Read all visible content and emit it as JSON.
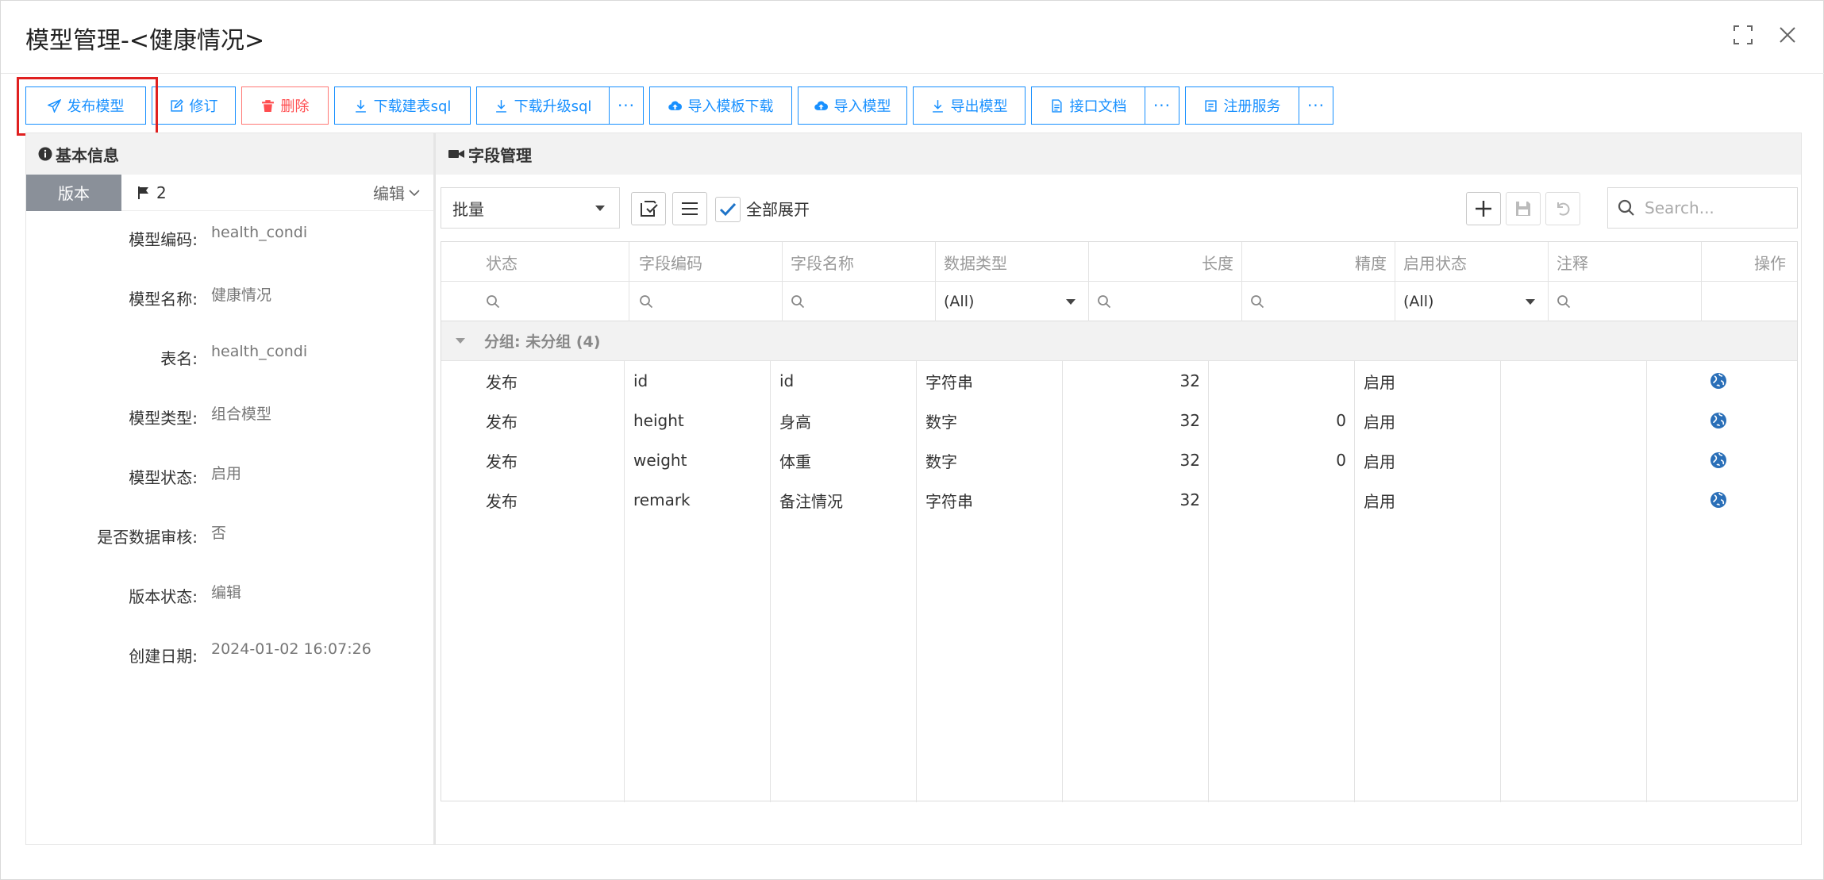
{
  "window": {
    "title": "模型管理-<健康情况>"
  },
  "toolbar": {
    "publish": "发布模型",
    "revise": "修订",
    "delete": "删除",
    "download_create_sql": "下载建表sql",
    "download_upgrade_sql": "下载升级sql",
    "import_template_download": "导入模板下载",
    "import_model": "导入模型",
    "export_model": "导出模型",
    "api_doc": "接口文档",
    "register_service": "注册服务",
    "more": "···"
  },
  "left_panel": {
    "title": "基本信息",
    "version_tab": "版本",
    "version_number": "2",
    "edit_label": "编辑",
    "fields": [
      {
        "label": "模型编码:",
        "value": "health_condi"
      },
      {
        "label": "模型名称:",
        "value": "健康情况"
      },
      {
        "label": "表名:",
        "value": "health_condi"
      },
      {
        "label": "模型类型:",
        "value": "组合模型"
      },
      {
        "label": "模型状态:",
        "value": "启用"
      },
      {
        "label": "是否数据审核:",
        "value": "否"
      },
      {
        "label": "版本状态:",
        "value": "编辑"
      },
      {
        "label": "创建日期:",
        "value": "2024-01-02 16:07:26"
      }
    ]
  },
  "right_panel": {
    "title": "字段管理",
    "batch_select": "批量",
    "expand_all": "全部展开",
    "search_placeholder": "Search...",
    "columns": [
      "状态",
      "字段编码",
      "字段名称",
      "数据类型",
      "长度",
      "精度",
      "启用状态",
      "注释",
      "操作"
    ],
    "filter_all": "(All)",
    "group_label": "分组: 未分组 (4)",
    "rows": [
      {
        "status": "发布",
        "code": "id",
        "name": "id",
        "type": "字符串",
        "length": "32",
        "precision": "",
        "enabled": "启用",
        "comment": ""
      },
      {
        "status": "发布",
        "code": "height",
        "name": "身高",
        "type": "数字",
        "length": "32",
        "precision": "0",
        "enabled": "启用",
        "comment": ""
      },
      {
        "status": "发布",
        "code": "weight",
        "name": "体重",
        "type": "数字",
        "length": "32",
        "precision": "0",
        "enabled": "启用",
        "comment": ""
      },
      {
        "status": "发布",
        "code": "remark",
        "name": "备注情况",
        "type": "字符串",
        "length": "32",
        "precision": "",
        "enabled": "启用",
        "comment": ""
      }
    ]
  },
  "colors": {
    "primary": "#1890ff",
    "danger": "#ff4d4f",
    "highlight": "#e02020",
    "version_tab": "#8a9099",
    "globe": "#2a6fb8"
  }
}
